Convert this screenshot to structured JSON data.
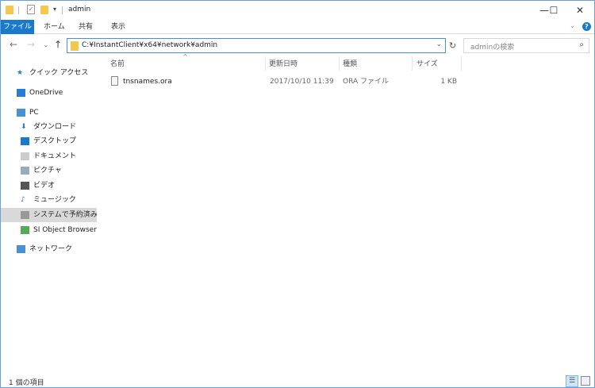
{
  "window": {
    "title": "admin",
    "minimize_icon": "minimize-icon",
    "maximize_icon": "maximize-icon",
    "close_icon": "close-icon"
  },
  "ribbon": {
    "tabs": [
      "ファイル",
      "ホーム",
      "共有",
      "表示"
    ]
  },
  "address": {
    "path": "C:¥InstantClient¥x64¥network¥admin"
  },
  "search": {
    "placeholder": "adminの検索"
  },
  "nav_pane": {
    "items": [
      {
        "label": "クイック アクセス",
        "icon": "star-icon"
      },
      {
        "label": "OneDrive",
        "icon": "cloud-icon"
      },
      {
        "label": "PC",
        "icon": "computer-icon"
      },
      {
        "label": "ダウンロード",
        "icon": "download-icon"
      },
      {
        "label": "デスクトップ",
        "icon": "desktop-icon"
      },
      {
        "label": "ドキュメント",
        "icon": "document-icon"
      },
      {
        "label": "ピクチャ",
        "icon": "picture-icon"
      },
      {
        "label": "ビデオ",
        "icon": "video-icon"
      },
      {
        "label": "ミュージック",
        "icon": "music-icon"
      },
      {
        "label": "システムで予約済み (",
        "icon": "drive-icon",
        "selected": true
      },
      {
        "label": "SI Object Browser (¥",
        "icon": "network-drive-icon"
      },
      {
        "label": "ネットワーク",
        "icon": "network-icon"
      }
    ]
  },
  "columns": {
    "name": "名前",
    "modified": "更新日時",
    "type": "種類",
    "size": "サイズ"
  },
  "files": [
    {
      "name": "tnsnames.ora",
      "modified": "2017/10/10 11:39",
      "type": "ORA ファイル",
      "size": "1 KB"
    }
  ],
  "status": {
    "count": "1 個の項目"
  },
  "colors": {
    "accent": "#1979ca",
    "selected": "#d9d9d9",
    "border": "#6aa0d8"
  }
}
